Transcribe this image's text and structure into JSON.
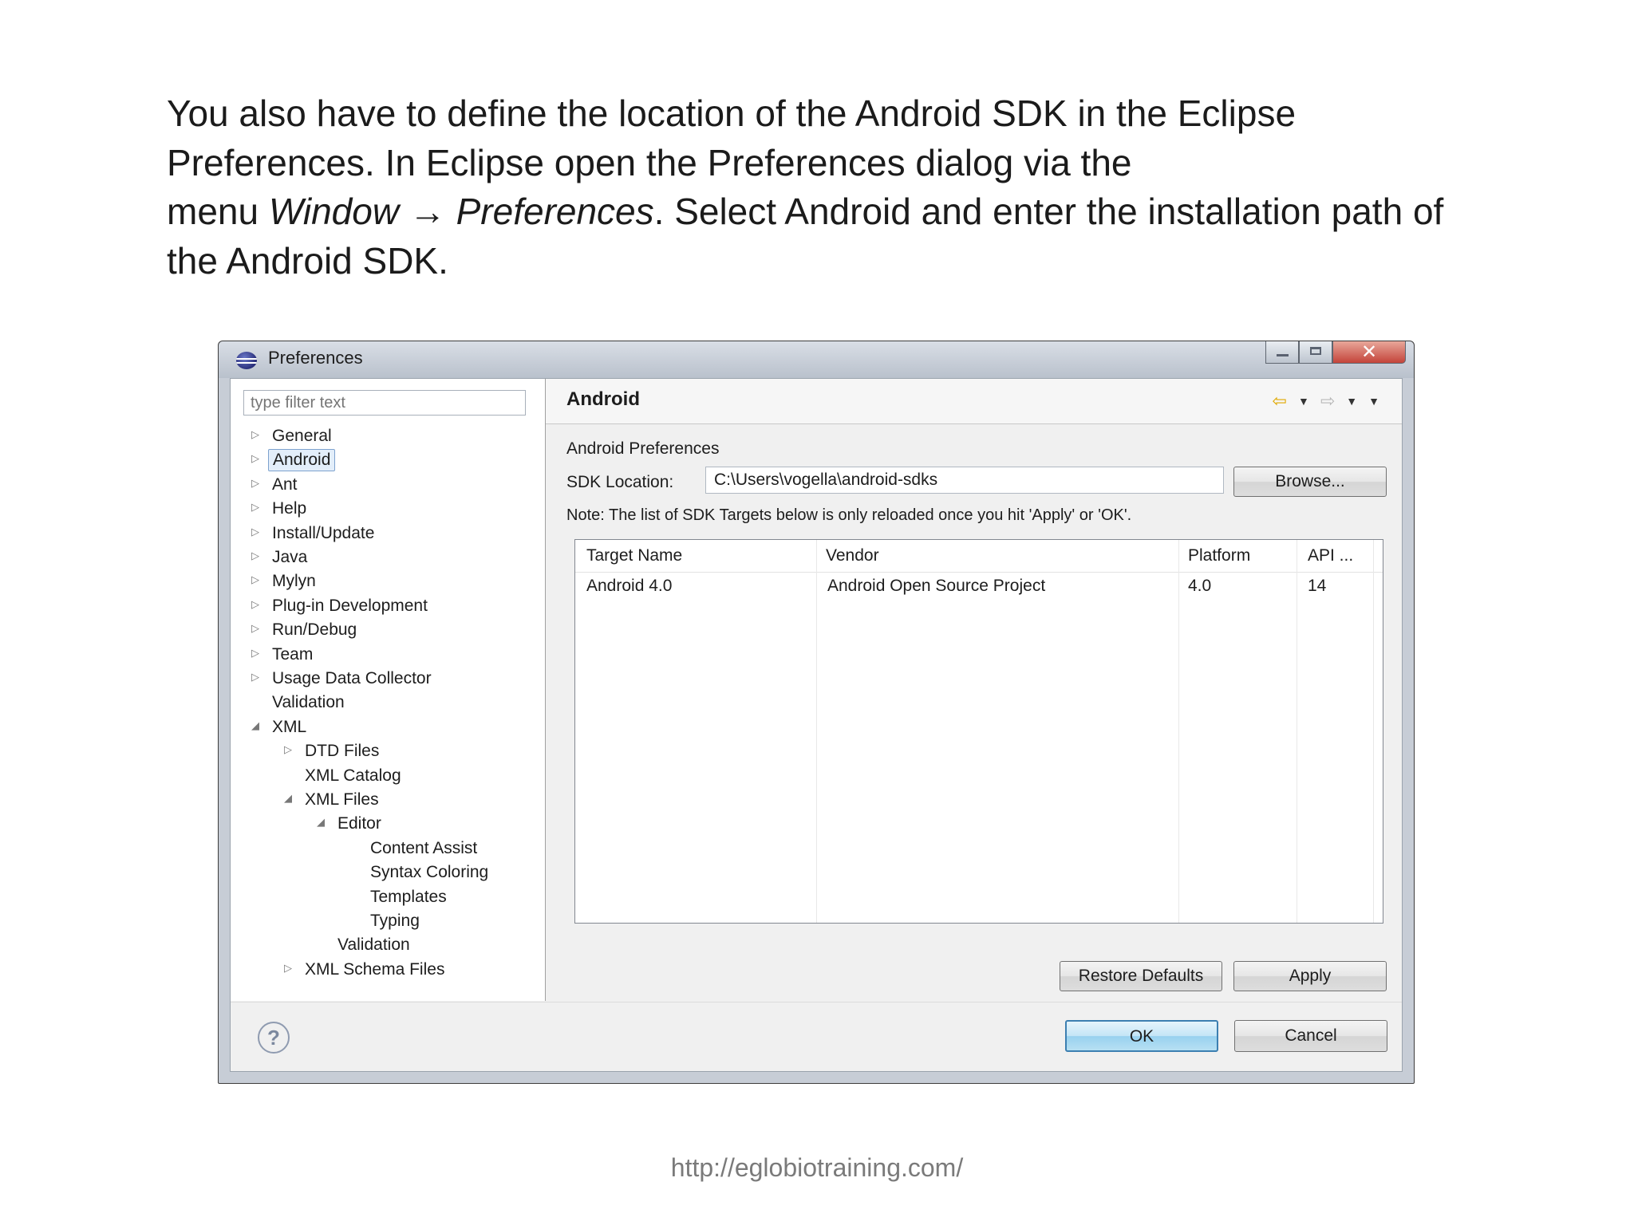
{
  "slide": {
    "line1": "You also have to define the location of the Android SDK in the Eclipse",
    "line2": "Preferences. In Eclipse open the Preferences dialog via the",
    "line3_prefix": "menu ",
    "line3_window": "Window",
    "line3_arrow": " → ",
    "line3_prefs": "Preferences",
    "line3_suffix": ". Select Android and enter the installation path of",
    "line4": "the Android SDK.",
    "footer_url": "http://eglobiotraining.com/"
  },
  "dialog": {
    "title": "Preferences",
    "filter_placeholder": "type filter text",
    "tree": [
      {
        "label": "General",
        "arrow": "▷"
      },
      {
        "label": "Android",
        "arrow": "▷",
        "selected": true
      },
      {
        "label": "Ant",
        "arrow": "▷"
      },
      {
        "label": "Help",
        "arrow": "▷"
      },
      {
        "label": "Install/Update",
        "arrow": "▷"
      },
      {
        "label": "Java",
        "arrow": "▷"
      },
      {
        "label": "Mylyn",
        "arrow": "▷"
      },
      {
        "label": "Plug-in Development",
        "arrow": "▷"
      },
      {
        "label": "Run/Debug",
        "arrow": "▷"
      },
      {
        "label": "Team",
        "arrow": "▷"
      },
      {
        "label": "Usage Data Collector",
        "arrow": "▷"
      },
      {
        "label": "Validation",
        "arrow": ""
      },
      {
        "label": "XML",
        "arrow": "◢"
      },
      {
        "label": "DTD Files",
        "arrow": "▷"
      },
      {
        "label": "XML Catalog",
        "arrow": ""
      },
      {
        "label": "XML Files",
        "arrow": "◢"
      },
      {
        "label": "Editor",
        "arrow": "◢"
      },
      {
        "label": "Content Assist",
        "arrow": ""
      },
      {
        "label": "Syntax Coloring",
        "arrow": ""
      },
      {
        "label": "Templates",
        "arrow": ""
      },
      {
        "label": "Typing",
        "arrow": ""
      },
      {
        "label": "Validation",
        "arrow": ""
      },
      {
        "label": "XML Schema Files",
        "arrow": "▷"
      }
    ],
    "page_title": "Android",
    "section_label": "Android Preferences",
    "sdk_label": "SDK Location:",
    "sdk_value": "C:\\Users\\vogella\\android-sdks",
    "browse_label": "Browse...",
    "note": "Note: The list of SDK Targets below is only reloaded once you hit 'Apply' or 'OK'.",
    "table": {
      "headers": [
        "Target Name",
        "Vendor",
        "Platform",
        "API ..."
      ],
      "rows": [
        [
          "Android 4.0",
          "Android Open Source Project",
          "4.0",
          "14"
        ]
      ]
    },
    "restore_label": "Restore Defaults",
    "apply_label": "Apply",
    "ok_label": "OK",
    "cancel_label": "Cancel",
    "help_glyph": "?",
    "close_glyph": "✕",
    "nav_back_glyph": "⇦",
    "nav_forward_glyph": "⇨",
    "nav_dropdown_glyph": "▼"
  }
}
